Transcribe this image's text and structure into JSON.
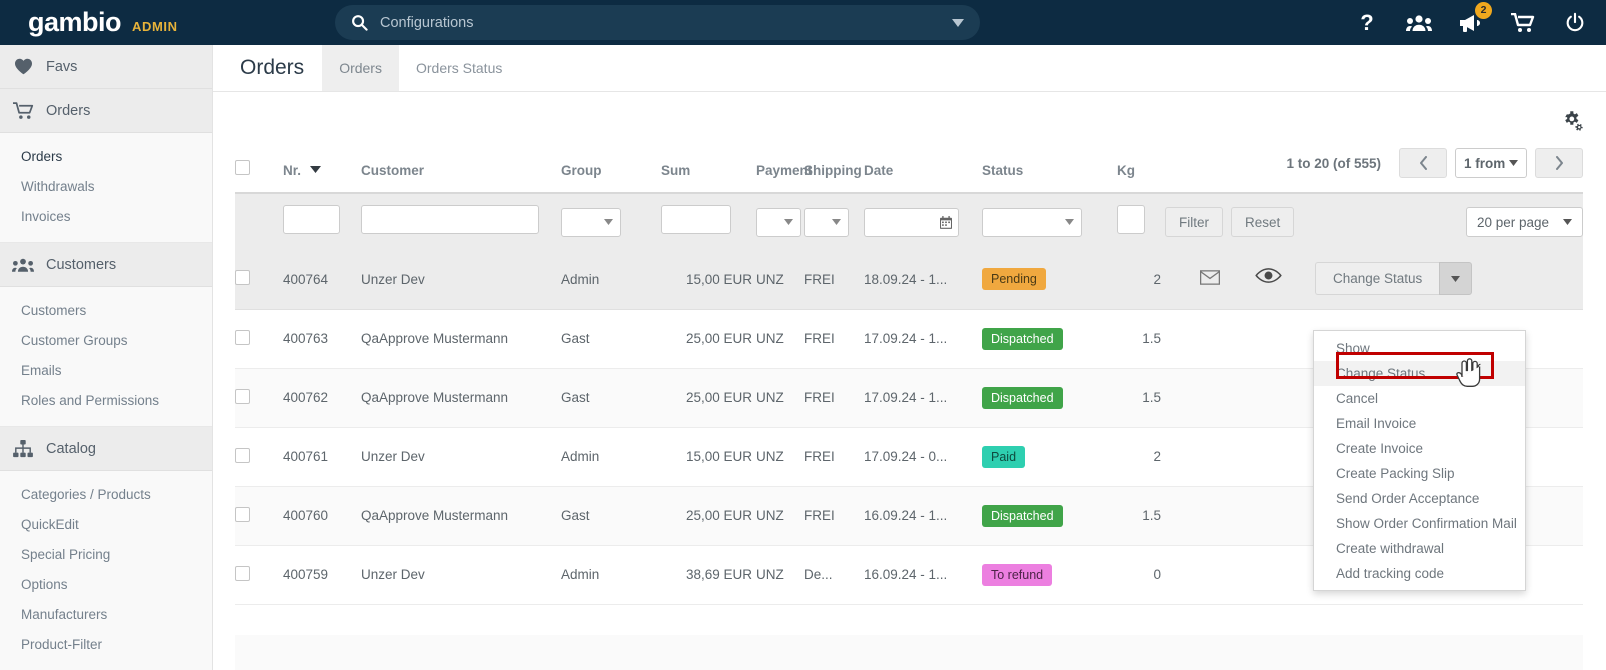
{
  "topbar": {
    "brand": "gambio",
    "brand_sub": "ADMIN",
    "search_placeholder": "Configurations",
    "icons": [
      {
        "name": "help-icon",
        "glyph": "?"
      },
      {
        "name": "users-icon",
        "glyph": "users"
      },
      {
        "name": "announcements-icon",
        "glyph": "megaphone",
        "badge": "2"
      },
      {
        "name": "cart-icon",
        "glyph": "cart"
      },
      {
        "name": "power-icon",
        "glyph": "power"
      }
    ]
  },
  "sidebar": {
    "groups": [
      {
        "label": "Favs",
        "icon": "heart-icon",
        "items": []
      },
      {
        "label": "Orders",
        "icon": "cart-icon",
        "items": [
          {
            "label": "Orders",
            "active": true
          },
          {
            "label": "Withdrawals",
            "active": false
          },
          {
            "label": "Invoices",
            "active": false
          }
        ]
      },
      {
        "label": "Customers",
        "icon": "people-icon",
        "items": [
          {
            "label": "Customers",
            "active": false
          },
          {
            "label": "Customer Groups",
            "active": false
          },
          {
            "label": "Emails",
            "active": false
          },
          {
            "label": "Roles and Permissions",
            "active": false
          }
        ]
      },
      {
        "label": "Catalog",
        "icon": "sitemap-icon",
        "items": [
          {
            "label": "Categories / Products",
            "active": false
          },
          {
            "label": "QuickEdit",
            "active": false
          },
          {
            "label": "Special Pricing",
            "active": false
          },
          {
            "label": "Options",
            "active": false
          },
          {
            "label": "Manufacturers",
            "active": false
          },
          {
            "label": "Product-Filter",
            "active": false
          }
        ]
      }
    ]
  },
  "page": {
    "title": "Orders",
    "tabs": [
      {
        "label": "Orders",
        "active": true
      },
      {
        "label": "Orders Status",
        "active": false
      }
    ],
    "settings_icon": "gears-icon"
  },
  "table": {
    "headers": {
      "nr": "Nr.",
      "customer": "Customer",
      "group": "Group",
      "sum": "Sum",
      "payment": "Payment",
      "shipping": "Shipping",
      "date": "Date",
      "status": "Status",
      "kg": "Kg"
    },
    "pagination": {
      "count_label": "1 to 20 (of 555)",
      "prev_icon": "chevron-left-icon",
      "next_icon": "chevron-right-icon",
      "page_select": "1 from"
    },
    "filter": {
      "filter_button": "Filter",
      "reset_button": "Reset",
      "per_page": "20 per page",
      "nr_value": "",
      "customer_value": "",
      "group_value": "",
      "sum_value": "",
      "payment_value": "",
      "shipping_value": "",
      "date_value": "",
      "status_value": "",
      "kg_value": ""
    },
    "rows": [
      {
        "nr": "400764",
        "customer": "Unzer Dev",
        "group": "Admin",
        "sum": "15,00 EUR",
        "payment": "UNZ",
        "shipping": "FREI",
        "date": "18.09.24 - 1...",
        "status": "Pending",
        "status_kind": "pending",
        "kg": "2",
        "has_mail_icon": true,
        "selected": true
      },
      {
        "nr": "400763",
        "customer": "QaApprove Mustermann",
        "group": "Gast",
        "sum": "25,00 EUR",
        "payment": "UNZ",
        "shipping": "FREI",
        "date": "17.09.24 - 1...",
        "status": "Dispatched",
        "status_kind": "dispatched",
        "kg": "1.5",
        "has_mail_icon": false,
        "selected": false
      },
      {
        "nr": "400762",
        "customer": "QaApprove Mustermann",
        "group": "Gast",
        "sum": "25,00 EUR",
        "payment": "UNZ",
        "shipping": "FREI",
        "date": "17.09.24 - 1...",
        "status": "Dispatched",
        "status_kind": "dispatched",
        "kg": "1.5",
        "has_mail_icon": false,
        "selected": false
      },
      {
        "nr": "400761",
        "customer": "Unzer Dev",
        "group": "Admin",
        "sum": "15,00 EUR",
        "payment": "UNZ",
        "shipping": "FREI",
        "date": "17.09.24 - 0...",
        "status": "Paid",
        "status_kind": "paid",
        "kg": "2",
        "has_mail_icon": false,
        "selected": false
      },
      {
        "nr": "400760",
        "customer": "QaApprove Mustermann",
        "group": "Gast",
        "sum": "25,00 EUR",
        "payment": "UNZ",
        "shipping": "FREI",
        "date": "16.09.24 - 1...",
        "status": "Dispatched",
        "status_kind": "dispatched",
        "kg": "1.5",
        "has_mail_icon": false,
        "selected": false
      },
      {
        "nr": "400759",
        "customer": "Unzer Dev",
        "group": "Admin",
        "sum": "38,69 EUR",
        "payment": "UNZ",
        "shipping": "De...",
        "date": "16.09.24 - 1...",
        "status": "To refund",
        "status_kind": "refund",
        "kg": "0",
        "has_mail_icon": false,
        "selected": false
      }
    ],
    "action_button": {
      "label": "Change Status",
      "toggle_icon": "caret-down-icon",
      "view_icon": "eye-icon"
    }
  },
  "dropdown": {
    "items": [
      {
        "label": "Show",
        "highlighted": false
      },
      {
        "label": "Change Status",
        "highlighted": true
      },
      {
        "label": "Cancel",
        "highlighted": false
      },
      {
        "label": "Email Invoice",
        "highlighted": false
      },
      {
        "label": "Create Invoice",
        "highlighted": false
      },
      {
        "label": "Create Packing Slip",
        "highlighted": false
      },
      {
        "label": "Send Order Acceptance",
        "highlighted": false
      },
      {
        "label": "Show Order Confirmation Mail",
        "highlighted": false
      },
      {
        "label": "Create withdrawal",
        "highlighted": false
      },
      {
        "label": "Add tracking code",
        "highlighted": false
      }
    ]
  },
  "colors": {
    "topbar_bg": "#0d2b42",
    "accent_yellow": "#e8b33a",
    "pending": "#f0a83f",
    "dispatched": "#40a449",
    "paid": "#2ecfb0",
    "refund": "#ec7fe0",
    "highlight_box": "#c00000"
  }
}
